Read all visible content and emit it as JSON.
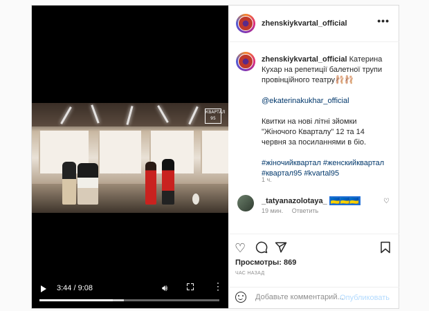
{
  "author": {
    "username": "zhenskiykvartal_official"
  },
  "caption": {
    "username": "zhenskiykvartal_official",
    "text": "Катерина Кухар на репетиції балетної трупи провінційного театру🩰🩰",
    "mention": "@ekaterinakukhar_official",
    "paragraph": "Квитки на нові літні зйомки \"Жіночого Кварталу\" 12 та 14 червня за посиланнями в біо.",
    "hashtags": "#жіночийквартал #женскийквартал #квартал95 #kvartal95",
    "time": "1 ч."
  },
  "comment": {
    "username": "_tatyanazolotaya_",
    "tag": "🇺🇦🇺🇦🇺🇦",
    "time": "19 мин.",
    "reply": "Ответить"
  },
  "video": {
    "current_time": "3:44",
    "duration": "9:08",
    "logo_text": "КВАРТАЛ 95",
    "played_fraction": 0.409,
    "buffered_fraction": 0.47
  },
  "stats": {
    "views_label": "Просмотры: 869",
    "posted_ago": "ЧАС НАЗАД"
  },
  "add_comment": {
    "placeholder": "Добавьте комментарий...",
    "publish_label": "Опубликовать"
  },
  "icons": {
    "more": "more-horizontal-icon",
    "like": "heart-icon",
    "comment": "comment-icon",
    "share": "paper-plane-icon",
    "save": "bookmark-icon",
    "emoji": "emoji-icon"
  },
  "colors": {
    "link": "#00376b",
    "publish_disabled": "#b3dbff",
    "meta_gray": "#8e8e8e"
  }
}
